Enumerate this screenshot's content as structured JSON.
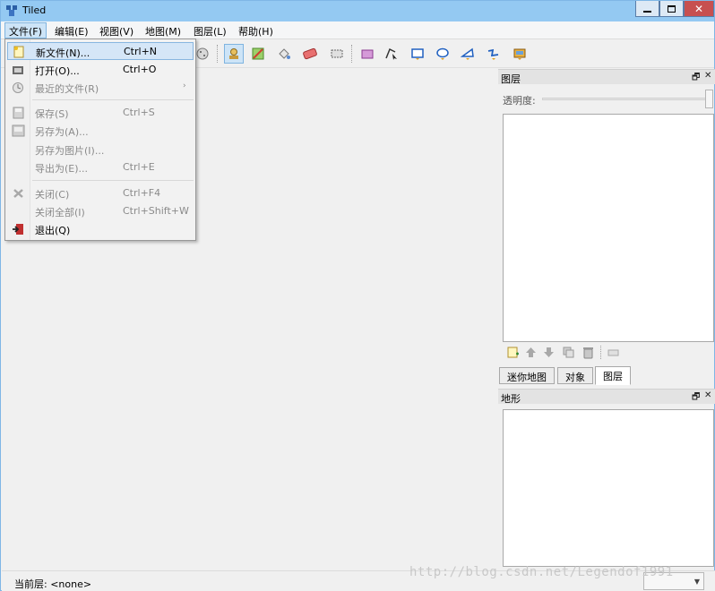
{
  "window": {
    "title": "Tiled",
    "close_glyph": "✕"
  },
  "menubar": {
    "items": [
      {
        "label": "文件(F)"
      },
      {
        "label": "编辑(E)"
      },
      {
        "label": "视图(V)"
      },
      {
        "label": "地图(M)"
      },
      {
        "label": "图层(L)"
      },
      {
        "label": "帮助(H)"
      }
    ]
  },
  "file_menu": {
    "items": [
      {
        "label": "新文件(N)...",
        "shortcut": "Ctrl+N",
        "icon": "new-file-icon"
      },
      {
        "label": "打开(O)...",
        "shortcut": "Ctrl+O",
        "icon": "open-icon"
      },
      {
        "label": "最近的文件(R)",
        "shortcut": "",
        "icon": "recent-icon"
      },
      {
        "label": "保存(S)",
        "shortcut": "Ctrl+S",
        "icon": "save-icon"
      },
      {
        "label": "另存为(A)...",
        "shortcut": "",
        "icon": "save-as-icon"
      },
      {
        "label": "另存为图片(I)...",
        "shortcut": "",
        "icon": ""
      },
      {
        "label": "导出为(E)...",
        "shortcut": "Ctrl+E",
        "icon": ""
      },
      {
        "label": "关闭(C)",
        "shortcut": "Ctrl+F4",
        "icon": "close-icon"
      },
      {
        "label": "关闭全部(I)",
        "shortcut": "Ctrl+Shift+W",
        "icon": ""
      },
      {
        "label": "退出(Q)",
        "shortcut": "",
        "icon": "exit-icon"
      }
    ],
    "submenu_arrow": "›"
  },
  "layers_panel": {
    "title": "图层",
    "float_glyph": "🗗",
    "close_glyph": "✕",
    "opacity_label": "透明度:"
  },
  "tabs": [
    {
      "label": "迷你地图"
    },
    {
      "label": "对象"
    },
    {
      "label": "图层"
    }
  ],
  "terrain_panel": {
    "title": "地形",
    "float_glyph": "🗗",
    "close_glyph": "✕"
  },
  "statusbar": {
    "current_layer_label": "当前层: <none>",
    "combo_arrow": "▼"
  },
  "watermark": "http://blog.csdn.net/Legendof1991",
  "colors": {
    "titlebar": "#94c9f2",
    "close_button": "#c75050",
    "menu_active": "#cde4f7",
    "menu_hover": "#d5e6f7"
  }
}
